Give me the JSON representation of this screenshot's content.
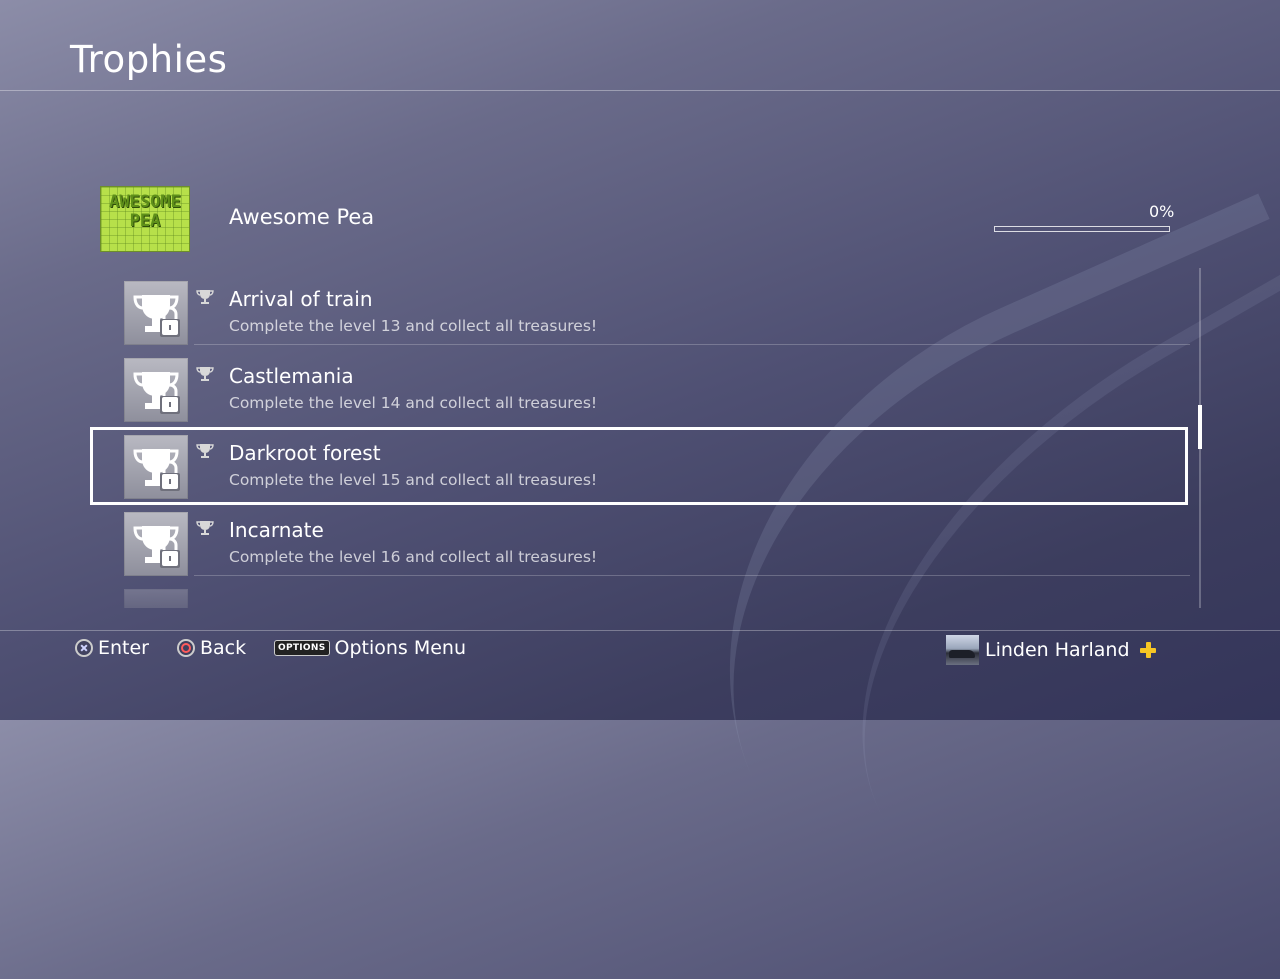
{
  "page": {
    "title": "Trophies"
  },
  "game": {
    "name": "Awesome Pea",
    "art_text": "AWESOME PEA",
    "progress_label": "0%",
    "progress_fraction": 0
  },
  "trophies": [
    {
      "name": "Arrival of train",
      "description": "Complete the level 13 and collect all treasures!",
      "type_icon": "bronze-trophy-icon",
      "locked": true
    },
    {
      "name": "Castlemania",
      "description": "Complete the level 14 and collect all treasures!",
      "type_icon": "bronze-trophy-icon",
      "locked": true
    },
    {
      "name": "Darkroot forest",
      "description": "Complete the level 15 and collect all treasures!",
      "type_icon": "bronze-trophy-icon",
      "locked": true,
      "selected": true
    },
    {
      "name": "Incarnate",
      "description": "Complete the level 16 and collect all treasures!",
      "type_icon": "bronze-trophy-icon",
      "locked": true
    }
  ],
  "footer": {
    "enter_label": "Enter",
    "back_label": "Back",
    "options_key": "OPTIONS",
    "options_label": "Options Menu",
    "user_name": "Linden Harland"
  },
  "colors": {
    "selection_border": "#ffffff",
    "plus_icon": "#f6c624",
    "cross_button": "#cfd3ff",
    "circle_button": "#ff5b5b"
  }
}
